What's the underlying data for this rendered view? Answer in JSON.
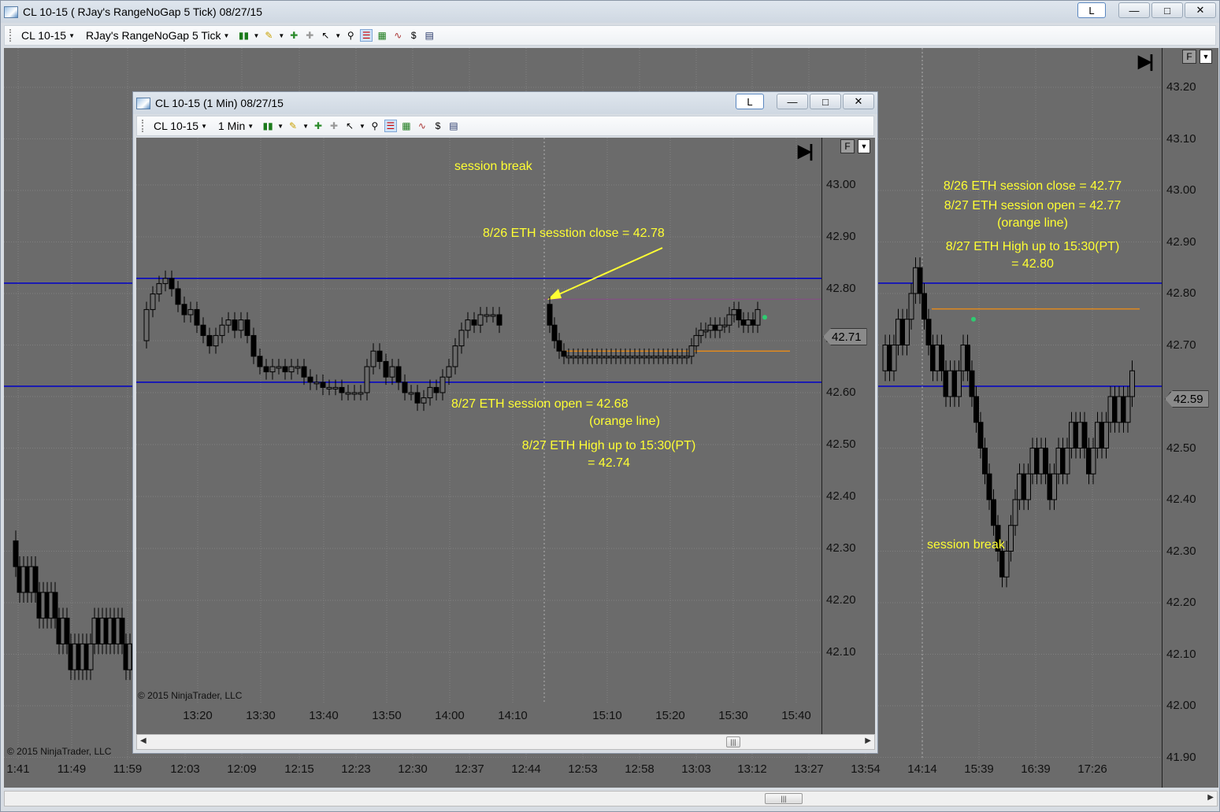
{
  "outer": {
    "title": "CL 10-15 ( RJay's RangeNoGap  5 Tick)  08/27/15",
    "l_label": "L",
    "toolbar": {
      "instrument": "CL 10-15",
      "bar_type": "RJay's RangeNoGap  5 Tick"
    },
    "y_ticks": [
      "43.20",
      "43.10",
      "43.00",
      "42.90",
      "42.80",
      "42.70",
      "42.60",
      "42.50",
      "42.40",
      "42.30",
      "42.20",
      "42.10",
      "42.00",
      "41.90"
    ],
    "x_ticks": [
      "1:41",
      "11:49",
      "11:59",
      "12:03",
      "12:09",
      "12:15",
      "12:23",
      "12:30",
      "12:37",
      "12:44",
      "12:53",
      "12:58",
      "13:03",
      "13:12",
      "13:27",
      "13:54",
      "14:14",
      "15:39",
      "16:39",
      "17:26"
    ],
    "last_price": "42.59",
    "copyright": "© 2015 NinjaTrader, LLC",
    "f_label": "F",
    "annotations": {
      "close": "8/26 ETH session close = 42.77",
      "open": "8/27 ETH session open = 42.77",
      "open_note": "(orange line)",
      "high": "8/27 ETH High up to 15:30(PT)",
      "high_val": "= 42.80",
      "session_break": "session break"
    }
  },
  "inner": {
    "title": "CL 10-15 (1 Min)  08/27/15",
    "l_label": "L",
    "toolbar": {
      "instrument": "CL 10-15",
      "bar_type": "1 Min"
    },
    "y_ticks": [
      "43.00",
      "42.90",
      "42.80",
      "42.70",
      "42.60",
      "42.50",
      "42.40",
      "42.30",
      "42.20",
      "42.10"
    ],
    "x_ticks": [
      "13:20",
      "13:30",
      "13:40",
      "13:50",
      "14:00",
      "14:10",
      "15:10",
      "15:20",
      "15:30",
      "15:40"
    ],
    "last_price": "42.71",
    "copyright": "© 2015 NinjaTrader, LLC",
    "f_label": "F",
    "annotations": {
      "session_break": "session break",
      "close": "8/26 ETH sesstion close = 42.78",
      "open": "8/27 ETH session open  = 42.68",
      "open_note": "(orange line)",
      "high": "8/27 ETH High up to 15:30(PT)",
      "high_val": "= 42.74"
    }
  },
  "colors": {
    "bg": "#6b6b6b",
    "blue_line": "#0000c8",
    "orange_line": "#e08a1e",
    "annotation": "#ffff33"
  }
}
